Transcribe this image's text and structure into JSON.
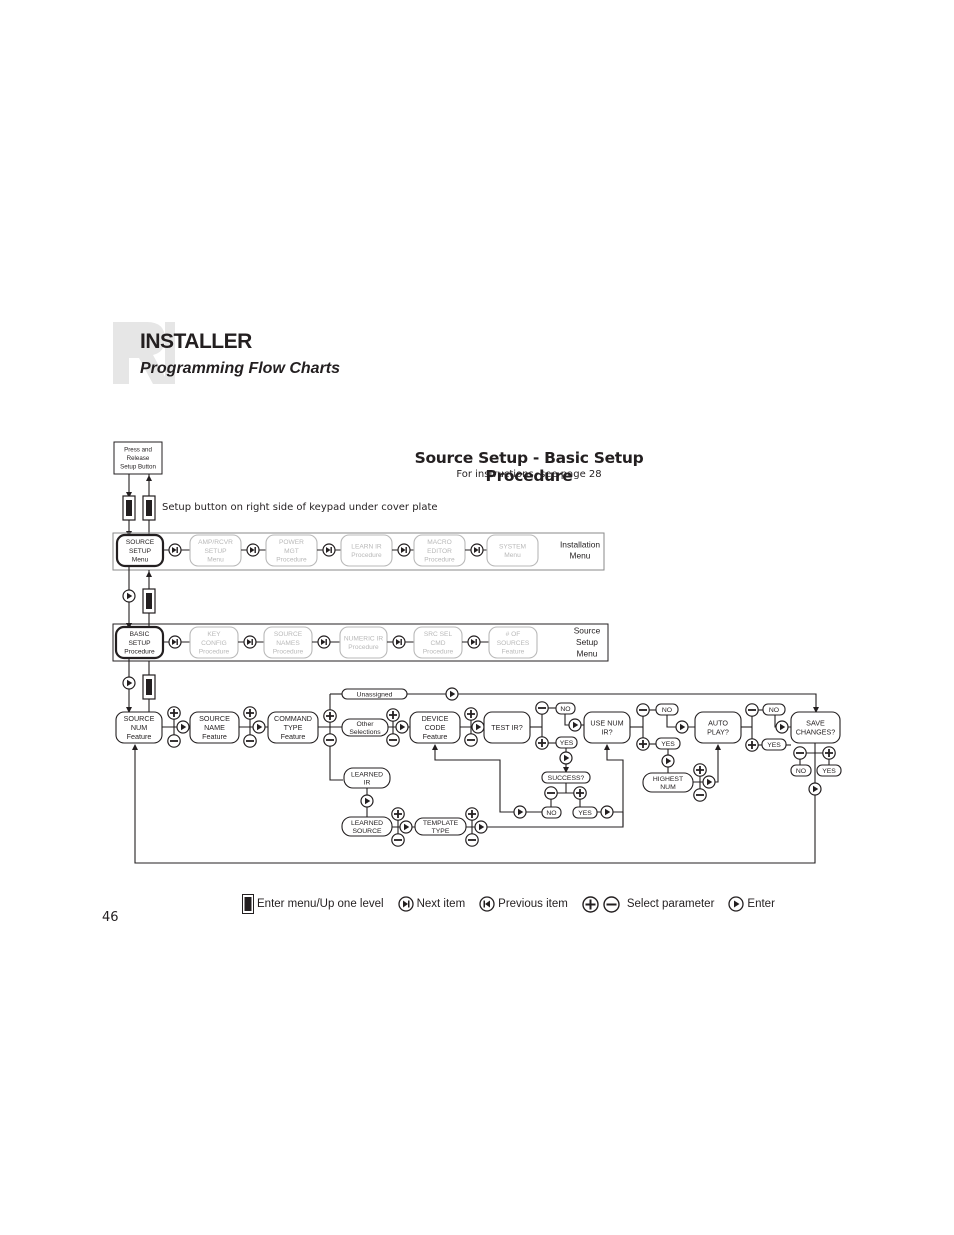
{
  "header": {
    "section_title": "INSTALLER",
    "section_subtitle": "Programming Flow Charts",
    "logo_icon": "ri-logo-mark"
  },
  "chart": {
    "title": "Source Setup - Basic Setup Procedure",
    "subtitle": "For instructions, see page 28",
    "start_box": [
      "Press and",
      "Release",
      "Setup Button"
    ],
    "setup_note": "Setup button on right side of keypad under cover plate",
    "installation_menu": {
      "label": [
        "Installation",
        "Menu"
      ],
      "items": [
        {
          "lines": [
            "SOURCE",
            "SETUP",
            "Menu"
          ],
          "active": true
        },
        {
          "lines": [
            "AMP/RCVR",
            "SETUP",
            "Menu"
          ],
          "active": false
        },
        {
          "lines": [
            "POWER",
            "MGT",
            "Procedure"
          ],
          "active": false
        },
        {
          "lines": [
            "LEARN IR",
            "Procedure"
          ],
          "active": false
        },
        {
          "lines": [
            "MACRO",
            "EDITOR",
            "Procedure"
          ],
          "active": false
        },
        {
          "lines": [
            "SYSTEM",
            "Menu"
          ],
          "active": false
        }
      ]
    },
    "source_setup_menu": {
      "label": [
        "Source",
        "Setup",
        "Menu"
      ],
      "items": [
        {
          "lines": [
            "BASIC",
            "SETUP",
            "Procedure"
          ],
          "active": true
        },
        {
          "lines": [
            "KEY",
            "CONFIG",
            "Procedure"
          ],
          "active": false
        },
        {
          "lines": [
            "SOURCE",
            "NAMES",
            "Procedure"
          ],
          "active": false
        },
        {
          "lines": [
            "NUMERIC IR",
            "Procedure"
          ],
          "active": false
        },
        {
          "lines": [
            "SRC SEL",
            "CMD",
            "Procedure"
          ],
          "active": false
        },
        {
          "lines": [
            "# OF",
            "SOURCES",
            "Feature"
          ],
          "active": false
        }
      ]
    },
    "procedure_nodes": {
      "source_num": [
        "SOURCE",
        "NUM",
        "Feature"
      ],
      "source_name": [
        "SOURCE",
        "NAME",
        "Feature"
      ],
      "command_type": [
        "COMMAND",
        "TYPE",
        "Feature"
      ],
      "unassigned": [
        "Unassigned"
      ],
      "other_selections": [
        "Other",
        "Selections"
      ],
      "learned_ir": [
        "LEARNED",
        "IR"
      ],
      "learned_source": [
        "LEARNED",
        "SOURCE"
      ],
      "template_type": [
        "TEMPLATE",
        "TYPE"
      ],
      "device_code": [
        "DEVICE",
        "CODE",
        "Feature"
      ],
      "test_ir": [
        "TEST IR?"
      ],
      "test_no": [
        "NO"
      ],
      "test_yes": [
        "YES"
      ],
      "success": [
        "SUCCESS?"
      ],
      "success_no": [
        "NO"
      ],
      "success_yes": [
        "YES"
      ],
      "use_num_ir": [
        "USE NUM",
        "IR?"
      ],
      "num_no": [
        "NO"
      ],
      "num_yes": [
        "YES"
      ],
      "highest_num": [
        "HIGHEST",
        "NUM"
      ],
      "auto_play": [
        "AUTO",
        "PLAY?"
      ],
      "auto_no": [
        "NO"
      ],
      "auto_yes": [
        "YES"
      ],
      "save_changes": [
        "SAVE",
        "CHANGES?"
      ],
      "save_no": [
        "NO"
      ],
      "save_yes": [
        "YES"
      ]
    }
  },
  "legend": [
    {
      "icon": "setup-button-icon",
      "label": "Enter menu/Up one level"
    },
    {
      "icon": "next-item-icon",
      "label": "Next item"
    },
    {
      "icon": "previous-item-icon",
      "label": "Previous item"
    },
    {
      "icon": "plus-minus-icon",
      "label": "Select parameter"
    },
    {
      "icon": "enter-icon",
      "label": "Enter"
    }
  ],
  "page_number": "46",
  "colors": {
    "ink": "#231f20",
    "inactive": "#b9b9b9",
    "logo": "#e6e6e6",
    "frame": "#8a8a8a"
  }
}
